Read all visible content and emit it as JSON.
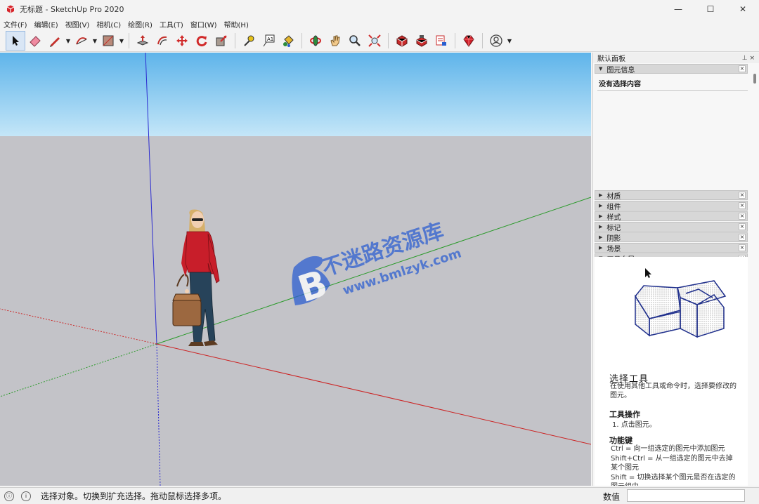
{
  "window": {
    "title": "无标题 - SketchUp Pro 2020",
    "minimize": "—",
    "maximize": "☐",
    "close": "✕"
  },
  "menu": [
    "文件(F)",
    "编辑(E)",
    "视图(V)",
    "相机(C)",
    "绘图(R)",
    "工具(T)",
    "窗口(W)",
    "帮助(H)"
  ],
  "toolbar": {
    "tools": [
      {
        "name": "select-tool",
        "icon": "arrow-icon",
        "active": true
      },
      {
        "name": "eraser-tool",
        "icon": "eraser-icon"
      },
      {
        "name": "line-tool",
        "icon": "pencil-icon",
        "dropdown": true
      },
      {
        "name": "arc-tool",
        "icon": "arc-icon",
        "dropdown": true
      },
      {
        "name": "rectangle-tool",
        "icon": "rectangle-icon",
        "dropdown": true
      },
      {
        "name": "push-pull-tool",
        "icon": "push-pull-icon"
      },
      {
        "name": "offset-tool",
        "icon": "offset-icon"
      },
      {
        "name": "move-tool",
        "icon": "move-icon"
      },
      {
        "name": "rotate-tool",
        "icon": "rotate-icon"
      },
      {
        "name": "scale-tool",
        "icon": "scale-icon"
      },
      {
        "name": "tape-measure-tool",
        "icon": "tape-measure-icon"
      },
      {
        "name": "text-tool",
        "icon": "text-icon"
      },
      {
        "name": "paint-bucket-tool",
        "icon": "paint-bucket-icon"
      },
      {
        "name": "orbit-tool",
        "icon": "orbit-icon"
      },
      {
        "name": "pan-tool",
        "icon": "hand-icon"
      },
      {
        "name": "zoom-tool",
        "icon": "magnifier-icon"
      },
      {
        "name": "zoom-extents-tool",
        "icon": "zoom-extents-icon"
      },
      {
        "name": "3d-warehouse-button",
        "icon": "warehouse-icon"
      },
      {
        "name": "extension-warehouse-button",
        "icon": "extension-warehouse-icon"
      },
      {
        "name": "layout-button",
        "icon": "send-to-layout-icon"
      },
      {
        "name": "extension-manager-button",
        "icon": "ruby-gem-icon"
      },
      {
        "name": "account-button",
        "icon": "user-icon",
        "dropdown": true
      }
    ]
  },
  "tray": {
    "title": "默认面板",
    "pin": "ᵖ",
    "entity_info": {
      "label": "图元信息",
      "empty_text": "没有选择内容"
    },
    "panels": [
      "材质",
      "组件",
      "样式",
      "标记",
      "阴影",
      "场景"
    ],
    "instructor": {
      "label": "工具向导",
      "heading": "选择工具",
      "description": "在使用其他工具或命令时，选择要修改的图元。",
      "operation_title": "工具操作",
      "operation_item": "1. 点击图元。",
      "keys_title": "功能键",
      "keys": [
        "Ctrl = 向一组选定的图元中添加图元",
        "Shift+Ctrl = 从一组选定的图元中去掉某个图元",
        "Shift = 切换选择某个图元是否在选定的图元组中"
      ]
    },
    "close_glyph": "×",
    "collapsed_arrow": "▶",
    "expanded_arrow": "▼"
  },
  "status": {
    "text": "选择对象。切换到扩充选择。拖动鼠标选择多项。",
    "measure_label": "数值",
    "measure_value": ""
  },
  "watermark": {
    "title": "不迷路资源库",
    "url": "www.bmlzyk.com",
    "logo_letter": "B"
  },
  "colors": {
    "sky_top": "#5eb4ea",
    "sky_bottom": "#bfe3f7",
    "ground": "#c3c3c8",
    "axis_red": "#cc2222",
    "axis_green": "#2a9a2a",
    "axis_blue": "#2b2bd0",
    "watermark_blue": "#2e5fd0"
  }
}
